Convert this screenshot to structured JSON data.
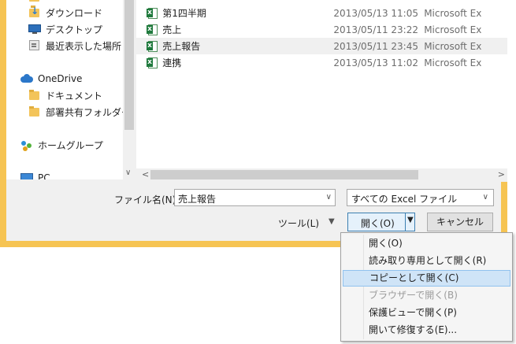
{
  "nav": {
    "items": [
      {
        "label": "ダウンロード"
      },
      {
        "label": "デスクトップ"
      },
      {
        "label": "最近表示した場所"
      },
      {
        "label": "OneDrive"
      },
      {
        "label": "ドキュメント"
      },
      {
        "label": "部署共有フォルダー"
      },
      {
        "label": "ホームグループ"
      },
      {
        "label": "PC"
      }
    ]
  },
  "files": [
    {
      "name": "第1四半期",
      "date": "2013/05/13 11:05",
      "type": "Microsoft Ex"
    },
    {
      "name": "売上",
      "date": "2013/05/11 23:22",
      "type": "Microsoft Ex"
    },
    {
      "name": "売上報告",
      "date": "2013/05/11 23:45",
      "type": "Microsoft Ex"
    },
    {
      "name": "連携",
      "date": "2013/05/13 11:02",
      "type": "Microsoft Ex"
    }
  ],
  "filename": {
    "label": "ファイル名(N):",
    "value": "売上報告"
  },
  "filetype": {
    "value": "すべての Excel ファイル"
  },
  "buttons": {
    "tools": "ツール(L)",
    "open": "開く(O)",
    "cancel": "キャンセル"
  },
  "open_menu": [
    {
      "label": "開く(O)",
      "state": "normal"
    },
    {
      "label": "読み取り専用として開く(R)",
      "state": "normal"
    },
    {
      "label": "コピーとして開く(C)",
      "state": "highlighted"
    },
    {
      "label": "ブラウザーで開く(B)",
      "state": "disabled"
    },
    {
      "label": "保護ビューで開く(P)",
      "state": "normal"
    },
    {
      "label": "開いて修復する(E)...",
      "state": "normal"
    }
  ],
  "colors": {
    "window_frame": "#f6c453",
    "accent": "#3c7fb1",
    "highlight": "#cfe4f7"
  }
}
